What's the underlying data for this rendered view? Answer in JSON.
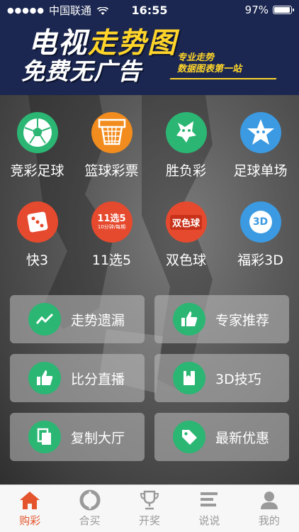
{
  "status_bar": {
    "signal": "●●●●●",
    "carrier": "中国联通",
    "time": "16:55",
    "battery_percent": "97%",
    "battery_level": 0.97
  },
  "banner": {
    "title_line1_white": "电视",
    "title_line1_yellow": "走势图",
    "title_line2": "免费无广告",
    "tagline_line1": "专业走势",
    "tagline_line2": "数据图表第一站"
  },
  "categories": [
    {
      "label": "竞彩足球",
      "icon": "soccer-ball-icon",
      "color": "#2bb673"
    },
    {
      "label": "篮球彩票",
      "icon": "basketball-hoop-icon",
      "color": "#f28c1e"
    },
    {
      "label": "胜负彩",
      "icon": "win-lose-lottery-icon",
      "color": "#2bb673"
    },
    {
      "label": "足球单场",
      "icon": "star-mascot-icon",
      "color": "#3b9ae1"
    },
    {
      "label": "快3",
      "icon": "dice-k3-icon",
      "color": "#e64a2e"
    },
    {
      "label": "11选5",
      "icon": "lottery-11x5-icon",
      "color": "#e64a2e",
      "icon_text": "11选5",
      "icon_subtext": "10分钟/每期"
    },
    {
      "label": "双色球",
      "icon": "double-color-ball-icon",
      "color": "#e64a2e",
      "icon_text": "双色球"
    },
    {
      "label": "福彩3D",
      "icon": "fucai-3d-icon",
      "color": "#3b9ae1",
      "icon_text": "3D"
    }
  ],
  "actions": [
    {
      "label": "走势遗漏",
      "icon": "trend-line-icon"
    },
    {
      "label": "专家推荐",
      "icon": "thumbs-up-icon"
    },
    {
      "label": "比分直播",
      "icon": "like-hand-icon"
    },
    {
      "label": "3D技巧",
      "icon": "book-icon"
    },
    {
      "label": "复制大厅",
      "icon": "copy-icon"
    },
    {
      "label": "最新优惠",
      "icon": "tag-icon"
    }
  ],
  "tabs": [
    {
      "label": "购彩",
      "icon": "home-icon",
      "active": true
    },
    {
      "label": "合买",
      "icon": "group-buy-icon",
      "active": false
    },
    {
      "label": "开奖",
      "icon": "trophy-icon",
      "active": false
    },
    {
      "label": "说说",
      "icon": "chat-icon",
      "active": false
    },
    {
      "label": "我的",
      "icon": "person-icon",
      "active": false
    }
  ],
  "colors": {
    "active_tab": "#e4552d",
    "inactive_tab": "#9a9a9a",
    "action_icon": "#2bb673",
    "banner_bg": "#1b2750",
    "banner_accent": "#ffd52a"
  }
}
